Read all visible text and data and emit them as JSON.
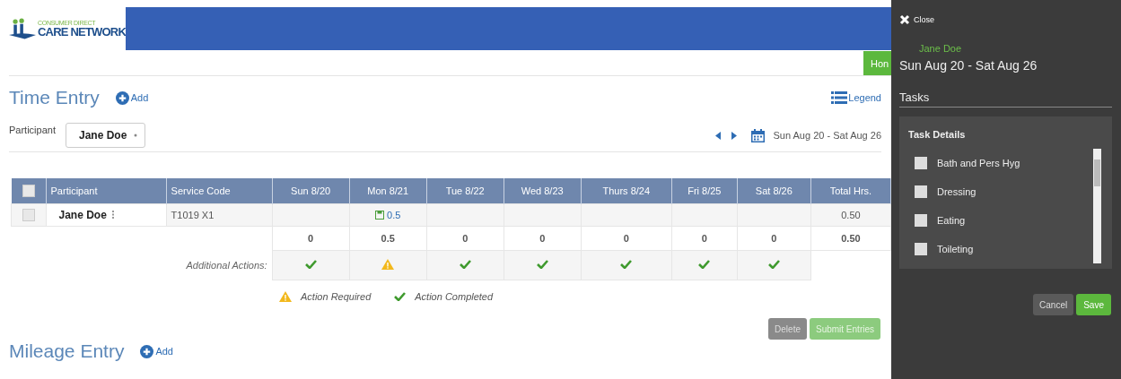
{
  "logo": {
    "line_1": "CONSUMER DIRECT",
    "line_2": "CARE NETWORK"
  },
  "home_button": "Hon",
  "time_entry": {
    "title": "Time Entry",
    "add": "Add",
    "legend": "Legend",
    "participant_label": "Participant",
    "participant_value": "Jane Doe",
    "week": "Sun Aug 20 - Sat Aug 26"
  },
  "table": {
    "select_all": {
      "checked": false
    },
    "columns": [
      "Participant",
      "Service Code",
      "Sun 8/20",
      "Mon 8/21",
      "Tue 8/22",
      "Wed 8/23",
      "Thurs 8/24",
      "Fri 8/25",
      "Sat 8/26",
      "Total Hrs."
    ],
    "rows": [
      {
        "checked": false,
        "participant": "Jane Doe",
        "service_code": "T1019 X1",
        "days": [
          {
            "kind": "empty"
          },
          {
            "kind": "entry",
            "hours": "0.5"
          },
          {
            "kind": "empty"
          },
          {
            "kind": "empty"
          },
          {
            "kind": "empty"
          },
          {
            "kind": "empty"
          },
          {
            "kind": "empty"
          }
        ],
        "total": "0.50"
      }
    ],
    "totals": [
      "0",
      "0.5",
      "0",
      "0",
      "0",
      "0",
      "0"
    ],
    "grand_total": "0.50",
    "actions_label": "Additional Actions:",
    "actions": [
      {
        "kind": "completed"
      },
      {
        "kind": "required"
      },
      {
        "kind": "completed"
      },
      {
        "kind": "completed"
      },
      {
        "kind": "completed"
      },
      {
        "kind": "completed"
      },
      {
        "kind": "completed"
      }
    ]
  },
  "legend_items": [
    {
      "kind": "required",
      "label": "Action Required"
    },
    {
      "kind": "completed",
      "label": "Action Completed"
    }
  ],
  "buttons": {
    "delete": "Delete",
    "submit": "Submit Entries"
  },
  "mileage": {
    "title": "Mileage Entry",
    "add": "Add"
  },
  "panel": {
    "close": "Close",
    "name": "Jane Doe",
    "week": "Sun Aug 20 - Sat Aug 26",
    "tasks_title": "Tasks",
    "details_title": "Task Details",
    "tasks": [
      {
        "label": "Bath and Pers Hyg",
        "checked": false
      },
      {
        "label": "Dressing",
        "checked": false
      },
      {
        "label": "Eating",
        "checked": false
      },
      {
        "label": "Toileting",
        "checked": false
      }
    ],
    "cancel": "Cancel",
    "save": "Save"
  }
}
